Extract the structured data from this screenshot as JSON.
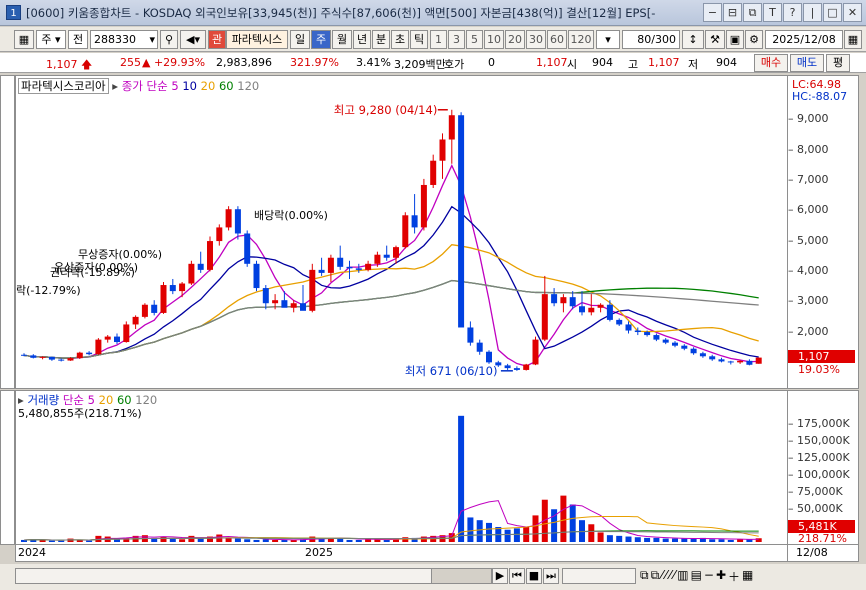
{
  "window": {
    "number": "1",
    "title": "[0600] 키움종합차트 - KOSDAQ 외국인보유[33,945(천)] 주식수[87,606(천)] 액면[500] 자본금[438(억)] 결산[12월] EPS[- ",
    "buttons": [
      "−",
      "⊟",
      "⧉",
      "T",
      "?",
      "|",
      "□",
      "✕"
    ]
  },
  "toolbar": {
    "type_sel": "주",
    "market_sel": "전",
    "code": "288330",
    "brand_badge": "관",
    "stock_name": "파라텍시스",
    "periods": [
      "일",
      "주",
      "월",
      "년",
      "분",
      "초",
      "틱"
    ],
    "period_selected": "주",
    "intervals": [
      "1",
      "3",
      "5",
      "10",
      "20",
      "30",
      "60",
      "120"
    ],
    "count": "80/300",
    "date": "2025/12/08"
  },
  "quote": {
    "price": "1,107",
    "change": "255",
    "change_pct": "+29.93%",
    "volume": "2,983,896",
    "vol_ratio": "321.97%",
    "turnover": "3.41%",
    "amount": "3,209백만",
    "hoga_label": "호가",
    "hoga": "0",
    "hoga_price": "1,107",
    "open_label": "시",
    "open": "904",
    "high_label": "고",
    "high": "1,107",
    "low_label": "저",
    "low": "904",
    "buy": "매수",
    "sell": "매도",
    "eval": "평"
  },
  "price_pane": {
    "name_label": "파라텍시스코리아",
    "ma_label": "종가 단순",
    "ma_periods": [
      {
        "p": "5",
        "color": "#c000c0"
      },
      {
        "p": "10",
        "color": "#0000a0"
      },
      {
        "p": "20",
        "color": "#e8a000"
      },
      {
        "p": "60",
        "color": "#008000"
      },
      {
        "p": "120",
        "color": "#808080"
      }
    ],
    "lc": "LC:64.98",
    "hc": "HC:-88.07",
    "y_ticks": [
      "9,000",
      "8,000",
      "7,000",
      "6,000",
      "5,000",
      "4,000",
      "3,000",
      "2,000"
    ],
    "last_price": "1,107",
    "last_pct": "19.03%",
    "high_note": "최고 9,280 (04/14)",
    "low_note": "최저 671 (06/10)",
    "annotations": [
      "배당락(0.00%)",
      "무상증자(0.00%)",
      "유상증자(0.00%)",
      "권리락(-15.89%)",
      "락(-12.79%)"
    ]
  },
  "volume_pane": {
    "title": "거래량",
    "ma_label": "단순",
    "ma_periods": [
      {
        "p": "5",
        "color": "#c000c0"
      },
      {
        "p": "20",
        "color": "#e8a000"
      },
      {
        "p": "60",
        "color": "#008000"
      },
      {
        "p": "120",
        "color": "#808080"
      }
    ],
    "value": "5,480,855주(218.71%)",
    "y_ticks": [
      "175,000K",
      "150,000K",
      "125,000K",
      "100,000K",
      "75,000K",
      "50,000K"
    ],
    "last_vol": "5,481K",
    "last_pct": "218.71%"
  },
  "x_axis": {
    "labels": [
      "2024",
      "2025"
    ],
    "end_label": "12/08"
  },
  "chart_data": {
    "type": "candlestick",
    "title": "",
    "ylim": [
      500,
      9800
    ],
    "candles": [
      [
        1200,
        1250,
        1150,
        1180
      ],
      [
        1180,
        1220,
        1080,
        1100
      ],
      [
        1100,
        1150,
        1050,
        1130
      ],
      [
        1130,
        1140,
        1000,
        1040
      ],
      [
        1040,
        1080,
        980,
        1010
      ],
      [
        1010,
        1120,
        1000,
        1090
      ],
      [
        1090,
        1300,
        1060,
        1270
      ],
      [
        1270,
        1320,
        1180,
        1220
      ],
      [
        1220,
        1750,
        1200,
        1700
      ],
      [
        1700,
        1850,
        1600,
        1800
      ],
      [
        1800,
        1900,
        1550,
        1620
      ],
      [
        1620,
        2300,
        1600,
        2200
      ],
      [
        2200,
        2500,
        2050,
        2450
      ],
      [
        2450,
        2900,
        2400,
        2850
      ],
      [
        2850,
        3000,
        2500,
        2580
      ],
      [
        2580,
        3600,
        2550,
        3500
      ],
      [
        3500,
        3700,
        3200,
        3300
      ],
      [
        3300,
        3600,
        3100,
        3550
      ],
      [
        3550,
        4300,
        3500,
        4200
      ],
      [
        4200,
        4600,
        3900,
        4000
      ],
      [
        4000,
        5100,
        3950,
        4950
      ],
      [
        4950,
        5500,
        4800,
        5400
      ],
      [
        5400,
        6100,
        5300,
        6000
      ],
      [
        6000,
        6100,
        5000,
        5200
      ],
      [
        5200,
        5300,
        4100,
        4200
      ],
      [
        4200,
        4300,
        3300,
        3400
      ],
      [
        3400,
        3500,
        2700,
        2900
      ],
      [
        2900,
        3200,
        2700,
        3000
      ],
      [
        3000,
        3300,
        2800,
        2750
      ],
      [
        2750,
        3000,
        2600,
        2900
      ],
      [
        2900,
        3500,
        2700,
        2650
      ],
      [
        2650,
        4200,
        2600,
        4000
      ],
      [
        4000,
        4400,
        3800,
        3900
      ],
      [
        3900,
        4500,
        3600,
        4400
      ],
      [
        4400,
        4800,
        4000,
        4100
      ],
      [
        4100,
        4300,
        3700,
        4050
      ],
      [
        4050,
        4200,
        3900,
        4000
      ],
      [
        4000,
        4300,
        3950,
        4200
      ],
      [
        4200,
        4600,
        4100,
        4500
      ],
      [
        4500,
        4800,
        4300,
        4400
      ],
      [
        4400,
        4800,
        4200,
        4750
      ],
      [
        4750,
        5900,
        4700,
        5800
      ],
      [
        5800,
        6500,
        5200,
        5400
      ],
      [
        5400,
        7000,
        5300,
        6800
      ],
      [
        6800,
        7800,
        6700,
        7600
      ],
      [
        7600,
        8500,
        7000,
        8300
      ],
      [
        8300,
        9280,
        7500,
        9100
      ],
      [
        9100,
        9200,
        2200,
        2100
      ],
      [
        2100,
        2300,
        1500,
        1600
      ],
      [
        1600,
        1700,
        1200,
        1300
      ],
      [
        1300,
        1350,
        900,
        950
      ],
      [
        950,
        1000,
        800,
        850
      ],
      [
        850,
        900,
        700,
        760
      ],
      [
        760,
        820,
        671,
        700
      ],
      [
        700,
        900,
        680,
        880
      ],
      [
        880,
        1800,
        860,
        1700
      ],
      [
        1700,
        3800,
        1650,
        3200
      ],
      [
        3200,
        3400,
        2800,
        2900
      ],
      [
        2900,
        3200,
        2600,
        3100
      ],
      [
        3100,
        3300,
        2700,
        2800
      ],
      [
        2800,
        3300,
        2500,
        2600
      ],
      [
        2600,
        3200,
        2500,
        2750
      ],
      [
        2750,
        2900,
        2600,
        2850
      ],
      [
        2850,
        3000,
        2300,
        2350
      ],
      [
        2350,
        2400,
        2150,
        2200
      ],
      [
        2200,
        2300,
        1900,
        2000
      ],
      [
        2000,
        2100,
        1850,
        1950
      ],
      [
        1950,
        2000,
        1800,
        1850
      ],
      [
        1850,
        1900,
        1650,
        1700
      ],
      [
        1700,
        1750,
        1550,
        1600
      ],
      [
        1600,
        1650,
        1450,
        1500
      ],
      [
        1500,
        1550,
        1350,
        1400
      ],
      [
        1400,
        1450,
        1200,
        1250
      ],
      [
        1250,
        1300,
        1100,
        1150
      ],
      [
        1150,
        1200,
        1000,
        1050
      ],
      [
        1050,
        1100,
        950,
        980
      ],
      [
        980,
        1000,
        880,
        950
      ],
      [
        950,
        1020,
        900,
        1000
      ],
      [
        1000,
        1050,
        852,
        870
      ],
      [
        904,
        1107,
        904,
        1107
      ]
    ],
    "volume": [
      3,
      4,
      3,
      2,
      2,
      5,
      3,
      2,
      9,
      8,
      5,
      6,
      9,
      10,
      6,
      8,
      5,
      4,
      9,
      6,
      8,
      11,
      6,
      5,
      4,
      3,
      4,
      3,
      3,
      3,
      4,
      8,
      5,
      6,
      5,
      3,
      3,
      4,
      4,
      3,
      5,
      7,
      6,
      8,
      9,
      10,
      13,
      185,
      36,
      32,
      28,
      22,
      18,
      20,
      22,
      39,
      62,
      48,
      68,
      55,
      32,
      26,
      14,
      10,
      9,
      8,
      7,
      6,
      6,
      5,
      5,
      5,
      5,
      6,
      4,
      4,
      3,
      4,
      4,
      5.5
    ]
  }
}
